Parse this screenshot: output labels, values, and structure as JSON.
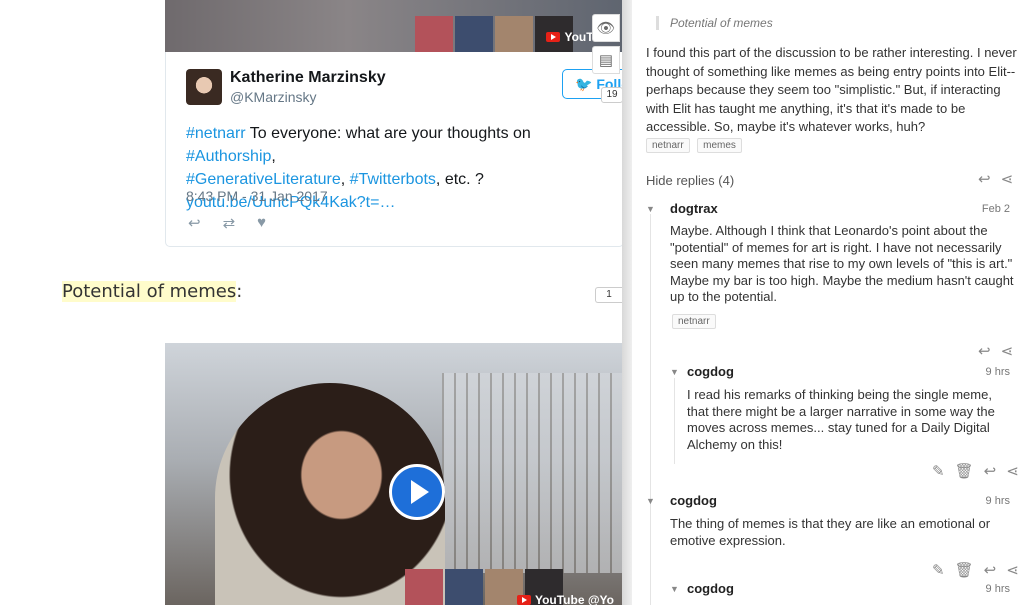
{
  "tweet": {
    "author_name": "Katherine Marzinsky",
    "author_handle": "@KMarzinsky",
    "follow_label": "Follow",
    "text_hashtag_1": "#netnarr",
    "text_mid_1": " To everyone: what are your thoughts on ",
    "text_hashtag_2": "#Authorship",
    "text_sep_1": ",",
    "text_hashtag_3": "#GenerativeLiterature",
    "text_sep_2": ", ",
    "text_hashtag_4": "#Twitterbots",
    "text_end": ", etc. ?",
    "link": "youtu.be/UuncPQk4Kak?t=…",
    "date": "8:43 PM - 31 Jan 2017"
  },
  "video": {
    "provider": "YouTube",
    "provider_bottom": "YouTube @Yo"
  },
  "section": {
    "heading": "Potential of memes",
    "heading_suffix": ":",
    "annotation_count": "1"
  },
  "side_controls": {
    "page_annotation_count": "19"
  },
  "sidebar": {
    "quote": "Potential of memes",
    "annotation_text": "I found this part of the discussion to be rather interesting. I never thought of something like memes as being entry points into Elit--perhaps because they seem too \"simplistic.\" But, if interacting with Elit has taught me anything, it's that it's made to be accessible. So, maybe it's whatever works, huh?",
    "tags": [
      "netnarr",
      "memes"
    ],
    "hide_replies": "Hide replies (4)",
    "replies": [
      {
        "user": "dogtrax",
        "time": "Feb 2",
        "text": "Maybe. Although I think that Leonardo's point about the \"potential\" of memes for art is right. I have not necessarily seen many memes that rise to my own levels of \"this is art.\" Maybe my bar is too high. Maybe the medium hasn't caught up to the potential.",
        "tag": "netnarr"
      },
      {
        "user": "cogdog",
        "time": "9 hrs",
        "text": "I read his remarks of thinking being the single meme, that there might be a larger narrative in some way the moves across memes... stay tuned for a Daily Digital Alchemy on this!"
      },
      {
        "user": "cogdog",
        "time": "9 hrs",
        "text": "The thing of memes is that they are like an emotional or emotive expression."
      },
      {
        "user": "cogdog",
        "time": "9 hrs"
      }
    ]
  }
}
